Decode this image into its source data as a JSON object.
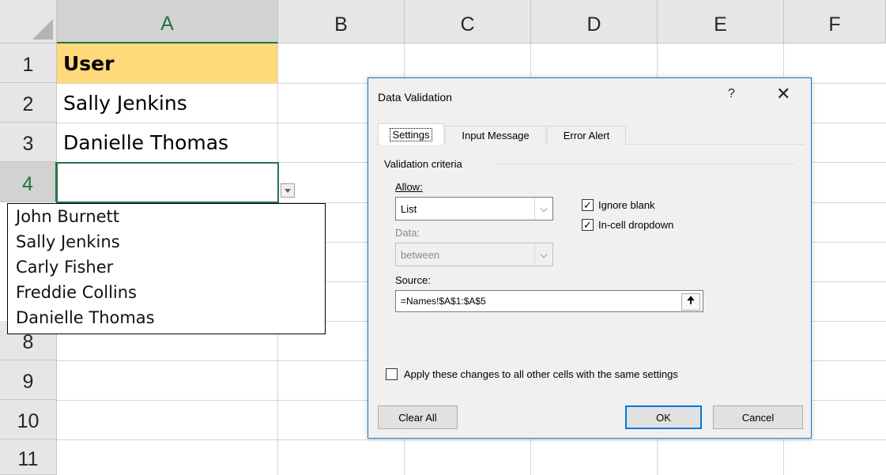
{
  "sheet": {
    "columns": [
      "A",
      "B",
      "C",
      "D",
      "E",
      "F"
    ],
    "rows": [
      "1",
      "2",
      "3",
      "4",
      "8",
      "9",
      "10",
      "11"
    ],
    "cells": {
      "a1": "User",
      "a2": "Sally Jenkins",
      "a3": "Danielle Thomas"
    },
    "colors": {
      "header_fill": "#FFD97A",
      "selection": "#217346"
    }
  },
  "dropdown_list": {
    "items": [
      "John Burnett",
      "Sally Jenkins",
      "Carly Fisher",
      "Freddie Collins",
      "Danielle Thomas"
    ]
  },
  "dialog": {
    "title": "Data Validation",
    "help": "?",
    "close": "✕",
    "tabs": [
      "Settings",
      "Input Message",
      "Error Alert"
    ],
    "group_label": "Validation criteria",
    "allow_label": "Allow:",
    "allow_value": "List",
    "data_label": "Data:",
    "data_value": "between",
    "ignore_blank_label": "Ignore blank",
    "ignore_blank_checked": true,
    "incell_dropdown_label": "In-cell dropdown",
    "incell_dropdown_checked": true,
    "source_label": "Source:",
    "source_value": "=Names!$A$1:$A$5",
    "apply_all_label": "Apply these changes to all other cells with the same settings",
    "apply_all_checked": false,
    "clear_all_label": "Clear All",
    "ok_label": "OK",
    "cancel_label": "Cancel"
  }
}
